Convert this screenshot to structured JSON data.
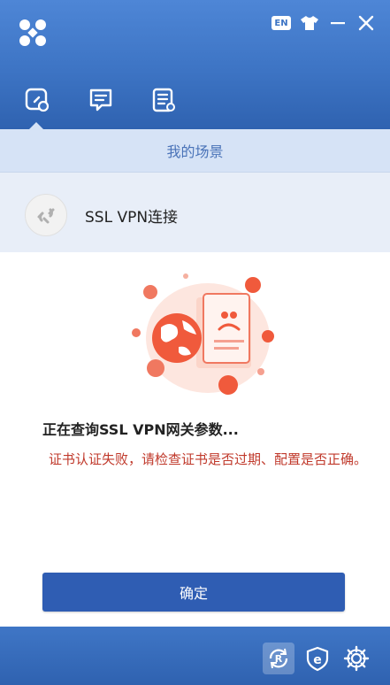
{
  "header": {
    "lang_badge": "EN",
    "tabs": [
      {
        "icon": "connection-icon",
        "active": true
      },
      {
        "icon": "message-icon",
        "active": false
      },
      {
        "icon": "log-list-icon",
        "active": false
      }
    ]
  },
  "scene": {
    "title": "我的场景",
    "connection_label": "SSL VPN连接"
  },
  "main": {
    "status": "正在查询SSL VPN网关参数...",
    "error": "证书认证失败，请检查证书是否过期、配置是否正确。",
    "ok_label": "确定"
  },
  "footer": {
    "icons": [
      "reconnect-r-icon",
      "browser-e-icon",
      "settings-gear-icon"
    ]
  },
  "colors": {
    "header": "#3d74c4",
    "accent_button": "#2f5db3",
    "error_text": "#c0392b",
    "illustration": "#f05a3c"
  }
}
